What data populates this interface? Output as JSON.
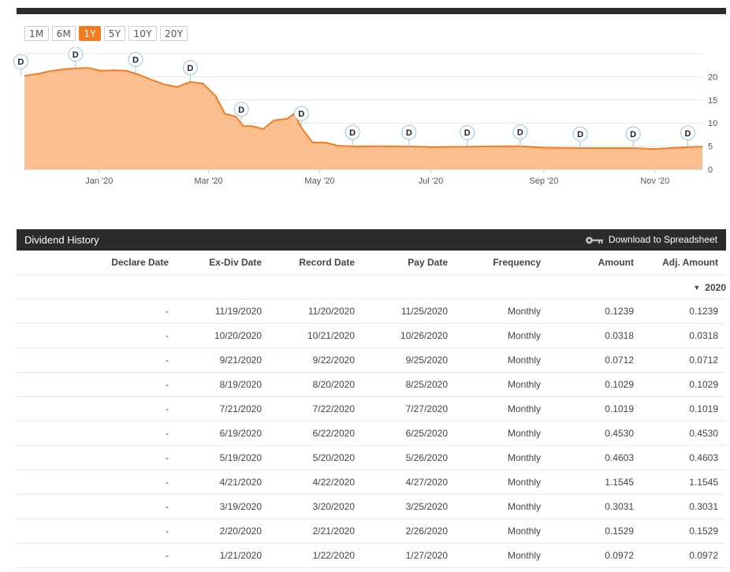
{
  "range_buttons": [
    {
      "label": "1M",
      "active": false
    },
    {
      "label": "6M",
      "active": false
    },
    {
      "label": "1Y",
      "active": true
    },
    {
      "label": "5Y",
      "active": false
    },
    {
      "label": "10Y",
      "active": false
    },
    {
      "label": "20Y",
      "active": false
    }
  ],
  "colors": {
    "accent": "#f47b20",
    "area_fill": "#fbbf8f",
    "header_bg": "#2b2b2b"
  },
  "chart_data": {
    "type": "area",
    "x_tick_labels": [
      "Jan '20",
      "Mar '20",
      "May '20",
      "Jul '20",
      "Sep '20",
      "Nov '20"
    ],
    "y_tick_labels": [
      "0",
      "5",
      "10",
      "15",
      "20"
    ],
    "ylim": [
      0,
      25
    ],
    "grid": true,
    "series": [
      {
        "name": "",
        "x": [
          "2019-11-21",
          "2019-11-28",
          "2019-12-05",
          "2019-12-12",
          "2019-12-19",
          "2019-12-26",
          "2020-01-02",
          "2020-01-09",
          "2020-01-16",
          "2020-01-23",
          "2020-01-30",
          "2020-02-06",
          "2020-02-13",
          "2020-02-20",
          "2020-02-27",
          "2020-03-05",
          "2020-03-10",
          "2020-03-16",
          "2020-03-20",
          "2020-03-25",
          "2020-03-31",
          "2020-04-06",
          "2020-04-13",
          "2020-04-17",
          "2020-04-21",
          "2020-04-27",
          "2020-05-04",
          "2020-05-11",
          "2020-05-19",
          "2020-06-01",
          "2020-06-19",
          "2020-07-01",
          "2020-07-21",
          "2020-08-01",
          "2020-08-19",
          "2020-09-01",
          "2020-09-21",
          "2020-10-01",
          "2020-10-20",
          "2020-11-01",
          "2020-11-19",
          "2020-11-27"
        ],
        "values": [
          20.2,
          20.6,
          21.2,
          21.6,
          21.8,
          21.9,
          21.3,
          21.4,
          21.3,
          20.4,
          19.3,
          18.3,
          17.8,
          18.9,
          18.5,
          15.8,
          12.0,
          11.4,
          9.4,
          9.3,
          8.7,
          10.6,
          10.9,
          12.0,
          9.0,
          5.8,
          5.8,
          5.1,
          4.95,
          5.0,
          4.95,
          4.8,
          4.9,
          4.95,
          5.0,
          4.7,
          4.6,
          4.6,
          4.6,
          4.4,
          4.8,
          4.9
        ]
      }
    ],
    "dividend_markers": [
      "D",
      "D",
      "D",
      "D",
      "D",
      "D",
      "D",
      "D",
      "D",
      "D",
      "D",
      "D"
    ],
    "dividend_marker_dates": [
      "2019-11-19",
      "2019-12-19",
      "2020-01-21",
      "2020-02-20",
      "2020-03-19",
      "2020-04-21",
      "2020-05-19",
      "2020-06-19",
      "2020-07-21",
      "2020-08-19",
      "2020-09-21",
      "2020-10-20",
      "2020-11-19"
    ]
  },
  "dividend_history": {
    "title": "Dividend History",
    "download_label": "Download to Spreadsheet",
    "columns": [
      "Declare Date",
      "Ex-Div Date",
      "Record Date",
      "Pay Date",
      "Frequency",
      "Amount",
      "Adj. Amount"
    ],
    "year": "2020",
    "rows": [
      [
        "-",
        "11/19/2020",
        "11/20/2020",
        "11/25/2020",
        "Monthly",
        "0.1239",
        "0.1239"
      ],
      [
        "-",
        "10/20/2020",
        "10/21/2020",
        "10/26/2020",
        "Monthly",
        "0.0318",
        "0.0318"
      ],
      [
        "-",
        "9/21/2020",
        "9/22/2020",
        "9/25/2020",
        "Monthly",
        "0.0712",
        "0.0712"
      ],
      [
        "-",
        "8/19/2020",
        "8/20/2020",
        "8/25/2020",
        "Monthly",
        "0.1029",
        "0.1029"
      ],
      [
        "-",
        "7/21/2020",
        "7/22/2020",
        "7/27/2020",
        "Monthly",
        "0.1019",
        "0.1019"
      ],
      [
        "-",
        "6/19/2020",
        "6/22/2020",
        "6/25/2020",
        "Monthly",
        "0.4530",
        "0.4530"
      ],
      [
        "-",
        "5/19/2020",
        "5/20/2020",
        "5/26/2020",
        "Monthly",
        "0.4603",
        "0.4603"
      ],
      [
        "-",
        "4/21/2020",
        "4/22/2020",
        "4/27/2020",
        "Monthly",
        "1.1545",
        "1.1545"
      ],
      [
        "-",
        "3/19/2020",
        "3/20/2020",
        "3/25/2020",
        "Monthly",
        "0.3031",
        "0.3031"
      ],
      [
        "-",
        "2/20/2020",
        "2/21/2020",
        "2/26/2020",
        "Monthly",
        "0.1529",
        "0.1529"
      ],
      [
        "-",
        "1/21/2020",
        "1/22/2020",
        "1/27/2020",
        "Monthly",
        "0.0972",
        "0.0972"
      ]
    ]
  }
}
